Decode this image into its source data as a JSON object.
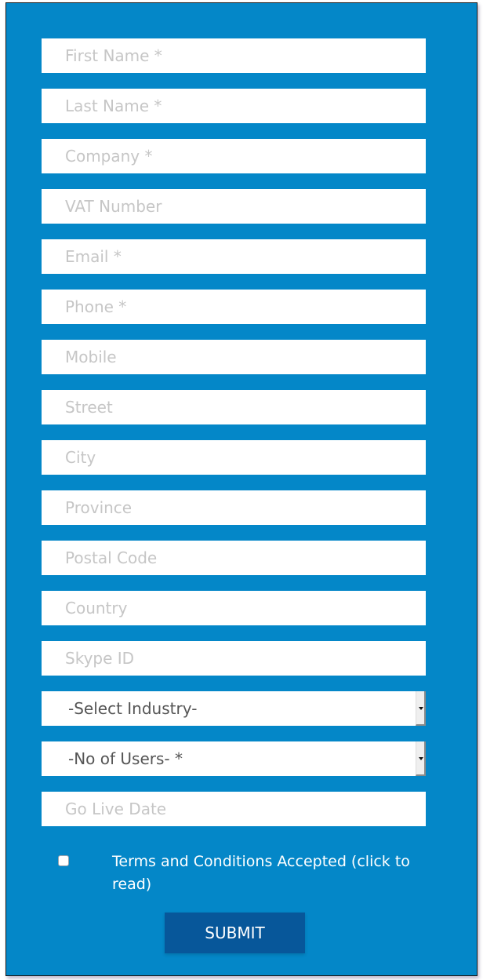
{
  "colors": {
    "background": "#0487c8",
    "field_bg": "#ffffff",
    "placeholder": "#c6c6c6",
    "submit_bg": "#07579a",
    "text_white": "#ffffff"
  },
  "form": {
    "fields": [
      {
        "name": "first-name",
        "placeholder": "First Name *",
        "value": ""
      },
      {
        "name": "last-name",
        "placeholder": "Last Name *",
        "value": ""
      },
      {
        "name": "company",
        "placeholder": "Company *",
        "value": ""
      },
      {
        "name": "vat-number",
        "placeholder": "VAT Number",
        "value": ""
      },
      {
        "name": "email",
        "placeholder": "Email *",
        "value": ""
      },
      {
        "name": "phone",
        "placeholder": "Phone *",
        "value": ""
      },
      {
        "name": "mobile",
        "placeholder": "Mobile",
        "value": ""
      },
      {
        "name": "street",
        "placeholder": "Street",
        "value": ""
      },
      {
        "name": "city",
        "placeholder": "City",
        "value": ""
      },
      {
        "name": "province",
        "placeholder": "Province",
        "value": ""
      },
      {
        "name": "postal-code",
        "placeholder": "Postal Code",
        "value": ""
      },
      {
        "name": "country",
        "placeholder": "Country",
        "value": ""
      },
      {
        "name": "skype-id",
        "placeholder": "Skype ID",
        "value": ""
      }
    ],
    "selects": {
      "industry": {
        "selected": "-Select Industry-",
        "icon": "chevron-down-icon"
      },
      "users": {
        "selected": "-No of Users- *",
        "icon": "chevron-down-icon"
      }
    },
    "go_live": {
      "placeholder": "Go Live Date",
      "value": ""
    },
    "terms": {
      "label": "Terms and Conditions Accepted (click to read)",
      "checked": false
    },
    "submit_label": "SUBMIT"
  }
}
